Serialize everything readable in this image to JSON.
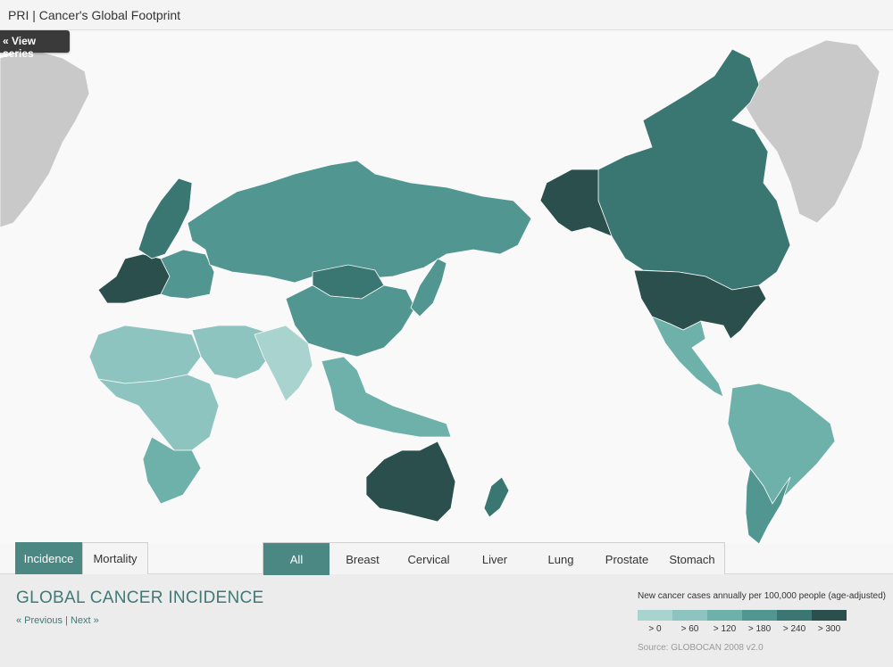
{
  "app": {
    "title": "PRI | Cancer's Global Footprint"
  },
  "nav": {
    "view_series": "« View series"
  },
  "measure_tabs": [
    {
      "label": "Incidence",
      "active": true
    },
    {
      "label": "Mortality",
      "active": false
    }
  ],
  "cancer_tabs": [
    {
      "label": "All",
      "active": true
    },
    {
      "label": "Breast",
      "active": false
    },
    {
      "label": "Cervical",
      "active": false
    },
    {
      "label": "Liver",
      "active": false
    },
    {
      "label": "Lung",
      "active": false
    },
    {
      "label": "Prostate",
      "active": false
    },
    {
      "label": "Stomach",
      "active": false
    }
  ],
  "panel": {
    "title": "GLOBAL CANCER INCIDENCE",
    "previous": "« Previous",
    "separator": "|",
    "next": "Next »"
  },
  "legend": {
    "title": "New cancer cases annually per 100,000 people (age-adjusted)",
    "bins": [
      {
        "label": "> 0",
        "color": "#a9d3cf"
      },
      {
        "label": "> 60",
        "color": "#8ec4bf"
      },
      {
        "label": "> 120",
        "color": "#6eb0aa"
      },
      {
        "label": "> 180",
        "color": "#519690"
      },
      {
        "label": "> 240",
        "color": "#3a7772"
      },
      {
        "label": "> 300",
        "color": "#2a4f4c"
      }
    ],
    "source": "Source: GLOBOCAN 2008 v2.0"
  },
  "map": {
    "no_data_color": "#c9c9c9",
    "regions": [
      {
        "name": "Greenland",
        "bin": -1
      },
      {
        "name": "Canada",
        "bin": 4
      },
      {
        "name": "USA",
        "bin": 5
      },
      {
        "name": "Alaska",
        "bin": 5
      },
      {
        "name": "Mexico & Central America",
        "bin": 2
      },
      {
        "name": "South America",
        "bin": 2
      },
      {
        "name": "Argentina / Chile",
        "bin": 3
      },
      {
        "name": "Western Europe",
        "bin": 5
      },
      {
        "name": "Scandinavia",
        "bin": 4
      },
      {
        "name": "Eastern Europe",
        "bin": 3
      },
      {
        "name": "Russia",
        "bin": 3
      },
      {
        "name": "Mongolia",
        "bin": 4
      },
      {
        "name": "China",
        "bin": 3
      },
      {
        "name": "Middle East",
        "bin": 1
      },
      {
        "name": "North Africa",
        "bin": 1
      },
      {
        "name": "Sub-Saharan Africa",
        "bin": 1
      },
      {
        "name": "Southern Africa",
        "bin": 2
      },
      {
        "name": "South Asia",
        "bin": 0
      },
      {
        "name": "Southeast Asia",
        "bin": 2
      },
      {
        "name": "Japan / Korea",
        "bin": 3
      },
      {
        "name": "Australia",
        "bin": 5
      },
      {
        "name": "New Zealand",
        "bin": 4
      }
    ]
  }
}
